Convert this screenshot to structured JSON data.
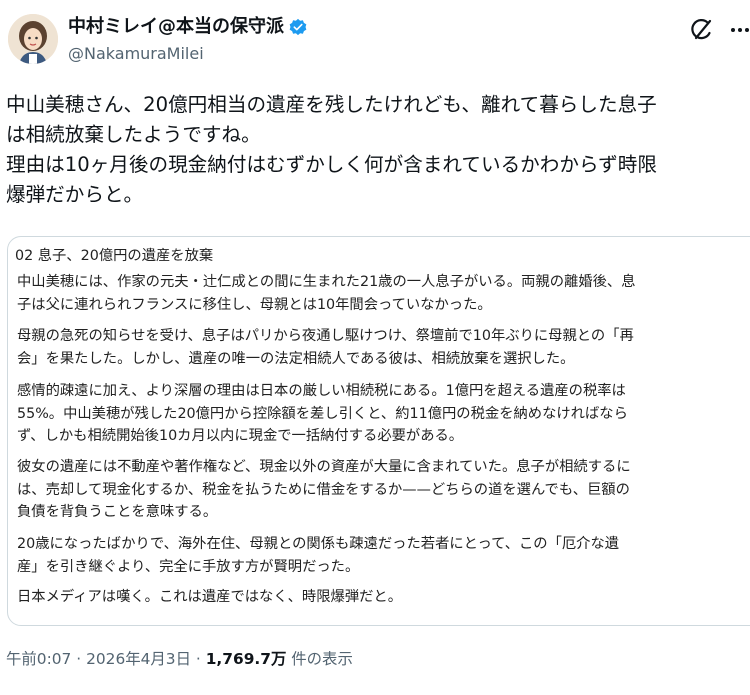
{
  "author": {
    "display_name": "中村ミレイ@本当の保守派",
    "handle": "@NakamuraMilei",
    "verified": true
  },
  "tweet": {
    "lines": [
      "中山美穂さん、20億円相当の遺産を残したけれども、離れて暮らした息子",
      "は相続放棄したようですね。",
      "理由は10ヶ月後の現金納付はむずかしく何が含まれているかわからず時限",
      "爆弾だからと。"
    ]
  },
  "quote": {
    "title": "02 息子、20億円の遺産を放棄",
    "paragraphs": [
      {
        "lines": [
          "中山美穂には、作家の元夫・辻仁成との間に生まれた21歳の一人息子がいる。両親の離婚後、息",
          "子は父に連れられフランスに移住し、母親とは10年間会っていなかった。"
        ]
      },
      {
        "lines": [
          "母親の急死の知らせを受け、息子はパリから夜通し駆けつけ、祭壇前で10年ぶりに母親との「再",
          "会」を果たした。しかし、遺産の唯一の法定相続人である彼は、相続放棄を選択した。"
        ]
      },
      {
        "lines": [
          "感情的疎遠に加え、より深層の理由は日本の厳しい相続税にある。1億円を超える遺産の税率は",
          "55%。中山美穂が残した20億円から控除額を差し引くと、約11億円の税金を納めなければなら",
          "ず、しかも相続開始後10カ月以内に現金で一括納付する必要がある。"
        ]
      },
      {
        "lines": [
          "彼女の遺産には不動産や著作権など、現金以外の資産が大量に含まれていた。息子が相続するに",
          "は、売却して現金化するか、税金を払うために借金をするか——どちらの道を選んでも、巨額の",
          "負債を背負うことを意味する。"
        ]
      },
      {
        "lines": [
          "20歳になったばかりで、海外在住、母親との関係も疎遠だった若者にとって、この「厄介な遺",
          "産」を引き継ぐより、完全に手放す方が賢明だった。"
        ]
      },
      {
        "lines": [
          "日本メディアは嘆く。これは遺産ではなく、時限爆弾だと。"
        ]
      }
    ]
  },
  "meta": {
    "time": "午前0:07",
    "separator": "·",
    "date": "2026年4月3日",
    "views_count": "1,769.7万",
    "views_label": "件の表示"
  },
  "icons": {
    "verified": "verified-badge-icon",
    "grok": "grok-icon",
    "more": "more-icon"
  },
  "colors": {
    "verified": "#1d9bf0",
    "secondary_text": "#536471",
    "border": "#cfd9de"
  }
}
